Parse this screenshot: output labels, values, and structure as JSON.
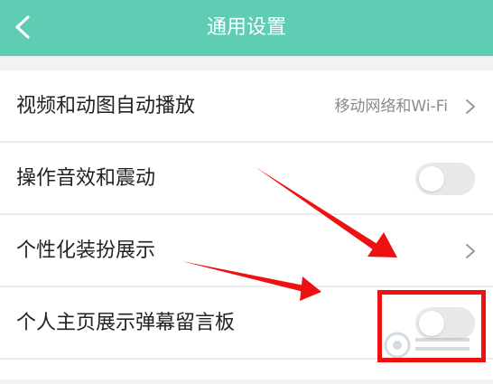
{
  "header": {
    "back_icon": "chevron-left-icon",
    "title": "通用设置",
    "color": "#5ecdb3"
  },
  "settings": [
    {
      "label": "视频和动图自动播放",
      "value": "移动网络和Wi-Fi",
      "control": "chevron-right-icon"
    },
    {
      "label": "操作音效和震动",
      "control": "toggle",
      "enabled": false
    },
    {
      "label": "个性化装扮展示",
      "control": "chevron-right-icon"
    },
    {
      "label": "个人主页展示弹幕留言板",
      "control": "toggle",
      "enabled": false
    }
  ],
  "annotations": {
    "arrow_color": "#ee1111",
    "highlight_color": "#ee1111"
  }
}
